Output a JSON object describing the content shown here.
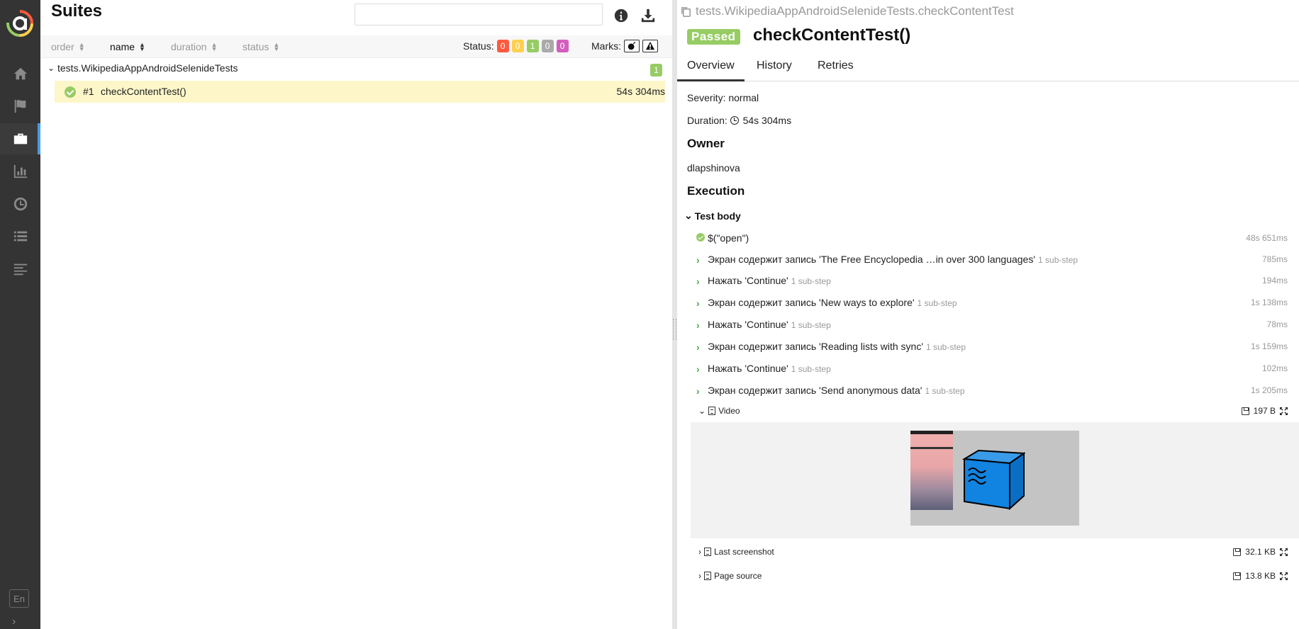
{
  "sidebar": {
    "items": [
      "home-icon",
      "flag-icon",
      "briefcase-icon",
      "bar-chart-icon",
      "clock-icon",
      "list-icon",
      "align-left-icon"
    ],
    "active_index": 2,
    "lang": "En"
  },
  "left": {
    "title": "Suites",
    "search_value": "",
    "sort": [
      {
        "label": "order",
        "active": false
      },
      {
        "label": "name",
        "active": true
      },
      {
        "label": "duration",
        "active": false
      },
      {
        "label": "status",
        "active": false
      }
    ],
    "status_label": "Status:",
    "status_counts": [
      {
        "name": "failed",
        "value": "0",
        "color": "#fd5a3e"
      },
      {
        "name": "broken",
        "value": "0",
        "color": "#ffd050"
      },
      {
        "name": "passed",
        "value": "1",
        "color": "#97cc64"
      },
      {
        "name": "skipped",
        "value": "0",
        "color": "#aaaaaa"
      },
      {
        "name": "unknown",
        "value": "0",
        "color": "#d35ebe"
      }
    ],
    "marks_label": "Marks:",
    "group": {
      "name": "tests.WikipediaAppAndroidSelenideTests",
      "count": "1"
    },
    "row": {
      "num": "#1",
      "name": "checkContentTest()",
      "duration": "54s 304ms"
    }
  },
  "right": {
    "path": "tests.WikipediaAppAndroidSelenideTests.checkContentTest",
    "status": "Passed",
    "name": "checkContentTest()",
    "tabs": [
      "Overview",
      "History",
      "Retries"
    ],
    "severity": "Severity: normal",
    "duration_label": "Duration:",
    "duration_value": "54s 304ms",
    "owner_heading": "Owner",
    "owner": "dlapshinova",
    "execution_heading": "Execution",
    "test_body": "Test body",
    "steps": [
      {
        "text": "$(\"open\")",
        "sub": "",
        "dur": "48s 651ms",
        "kind": "ok"
      },
      {
        "text": "Экран содержит запись 'The Free Encyclopedia …in over 300 languages'",
        "sub": "1 sub-step",
        "dur": "785ms",
        "kind": "chev"
      },
      {
        "text": "Нажать 'Continue'",
        "sub": "1 sub-step",
        "dur": "194ms",
        "kind": "chev"
      },
      {
        "text": "Экран содержит запись 'New ways to explore'",
        "sub": "1 sub-step",
        "dur": "1s 138ms",
        "kind": "chev"
      },
      {
        "text": "Нажать 'Continue'",
        "sub": "1 sub-step",
        "dur": "78ms",
        "kind": "chev"
      },
      {
        "text": "Экран содержит запись 'Reading lists with sync'",
        "sub": "1 sub-step",
        "dur": "1s 159ms",
        "kind": "chev"
      },
      {
        "text": "Нажать 'Continue'",
        "sub": "1 sub-step",
        "dur": "102ms",
        "kind": "chev"
      },
      {
        "text": "Экран содержит запись 'Send anonymous data'",
        "sub": "1 sub-step",
        "dur": "1s 205ms",
        "kind": "chev"
      }
    ],
    "attachments": [
      {
        "name": "Video",
        "size": "197 B",
        "expanded": true
      },
      {
        "name": "Last screenshot",
        "size": "32.1 KB",
        "expanded": false
      },
      {
        "name": "Page source",
        "size": "13.8 KB",
        "expanded": false
      }
    ]
  }
}
